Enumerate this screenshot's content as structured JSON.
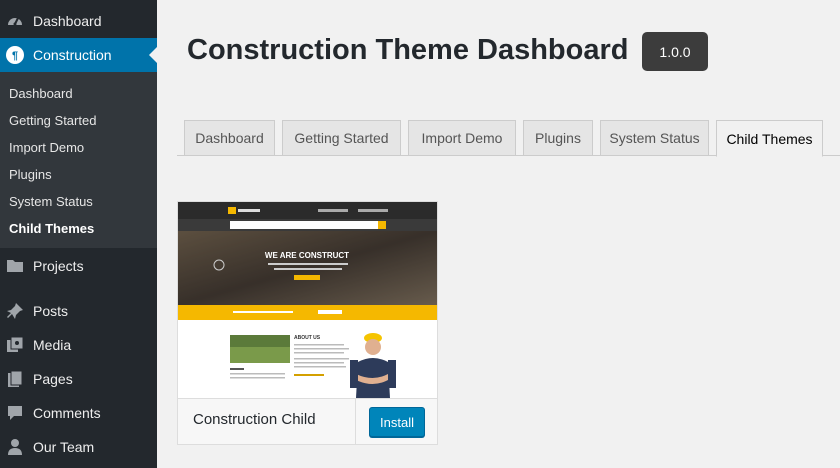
{
  "sidebar": {
    "top_items": [
      {
        "label": "Dashboard",
        "icon": "dashboard-icon"
      },
      {
        "label": "Construction",
        "icon": "construction-theme-icon",
        "active": true
      }
    ],
    "submenu": [
      {
        "label": "Dashboard"
      },
      {
        "label": "Getting Started"
      },
      {
        "label": "Import Demo"
      },
      {
        "label": "Plugins"
      },
      {
        "label": "System Status"
      },
      {
        "label": "Child Themes",
        "current": true
      }
    ],
    "bottom_items": [
      {
        "label": "Projects",
        "icon": "folder-icon"
      },
      {
        "label": "Posts",
        "icon": "pin-icon"
      },
      {
        "label": "Media",
        "icon": "media-icon"
      },
      {
        "label": "Pages",
        "icon": "pages-icon"
      },
      {
        "label": "Comments",
        "icon": "comment-icon"
      },
      {
        "label": "Our Team",
        "icon": "user-icon"
      }
    ]
  },
  "header": {
    "title": "Construction Theme Dashboard",
    "version": "1.0.0"
  },
  "tabs": [
    {
      "label": "Dashboard"
    },
    {
      "label": "Getting Started"
    },
    {
      "label": "Import Demo"
    },
    {
      "label": "Plugins"
    },
    {
      "label": "System Status"
    },
    {
      "label": "Child Themes",
      "active": true
    }
  ],
  "theme_card": {
    "name": "Construction Child",
    "install_label": "Install",
    "screenshot": {
      "hero_heading": "WE ARE CONSTRUCT",
      "about_heading": "ABOUT US"
    }
  },
  "colors": {
    "sidebar_bg": "#23282d",
    "submenu_bg": "#32373c",
    "accent": "#0073aa",
    "button": "#0085ba",
    "theme_yellow": "#f5b800"
  }
}
